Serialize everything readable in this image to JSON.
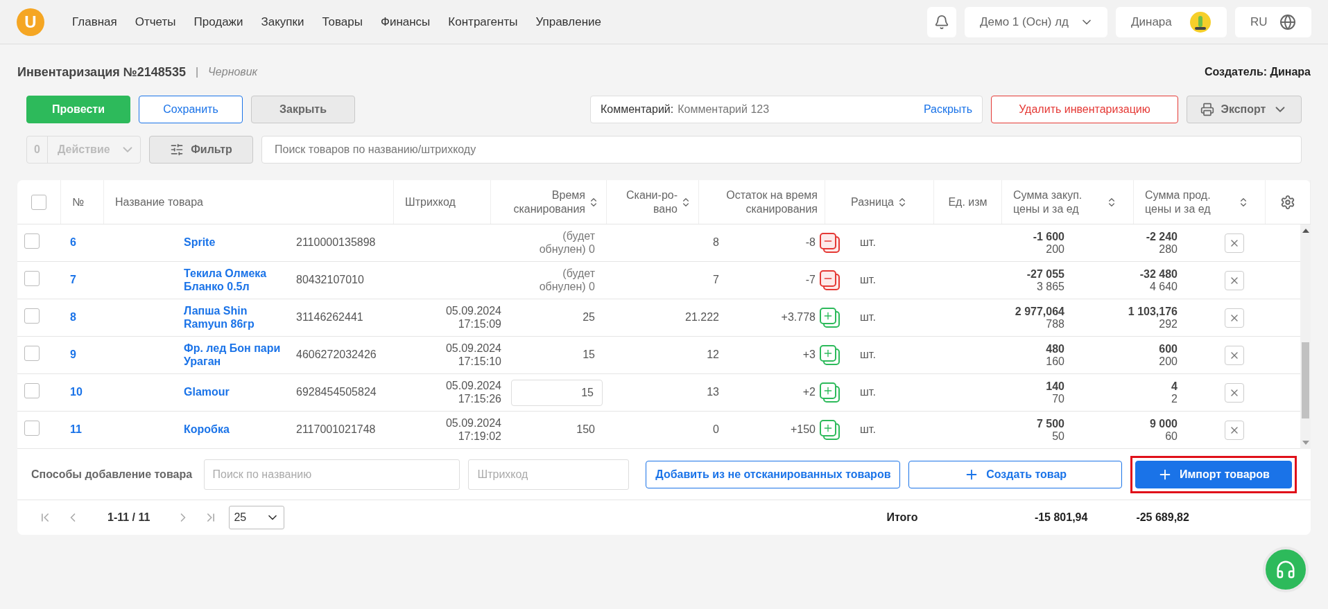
{
  "logo": "U",
  "nav": [
    "Главная",
    "Отчеты",
    "Продажи",
    "Закупки",
    "Товары",
    "Финансы",
    "Контрагенты",
    "Управление"
  ],
  "company": "Демо 1 (Осн) лд",
  "user": "Динара",
  "language": "RU",
  "doc": {
    "title": "Инвентаризация №2148535",
    "separator": "|",
    "status": "Черновик",
    "creator": "Создатель: Динара"
  },
  "actions": {
    "conduct": "Провести",
    "save": "Сохранить",
    "close": "Закрыть",
    "comment_label": "Комментарий:",
    "comment": "Комментарий 123",
    "expand": "Раскрыть",
    "delete": "Удалить инвентаризацию",
    "export": "Экспорт"
  },
  "toolbar": {
    "selected_count": "0",
    "action": "Действие",
    "filter": "Фильтр",
    "search_placeholder": "Поиск товаров по названию/штрихкоду"
  },
  "table": {
    "all_checked": false,
    "columns": [
      {
        "label": "№",
        "sortable": false
      },
      {
        "label": "Название товара",
        "sortable": false
      },
      {
        "label": "Штрихкод",
        "sortable": false
      },
      {
        "label": "Время сканирования",
        "sortable": true
      },
      {
        "label": "Скани-ро-вано",
        "sortable": true
      },
      {
        "label": "Остаток на время сканирования",
        "sortable": false
      },
      {
        "label": "Разница",
        "sortable": true
      },
      {
        "label": "Ед. изм",
        "sortable": false
      },
      {
        "label": "Сумма закуп. цены и за ед",
        "sortable": true
      },
      {
        "label": "Сумма прод. цены и за ед",
        "sortable": true
      }
    ],
    "rows": [
      {
        "checked": false,
        "no": "6",
        "name": "Sprite",
        "barcode": "2110000135898",
        "time": "",
        "scanned": {
          "kind": "reset",
          "text": "(будет обнулен) 0"
        },
        "remainder": "8",
        "difference": {
          "kind": "shortage",
          "text": "-8"
        },
        "unit": "шт.",
        "purchase": "-1 600",
        "purchase_unit": "200",
        "sale": "-2 240",
        "sale_unit": "280"
      },
      {
        "checked": false,
        "no": "7",
        "name": "Текила Олмека Бланко 0.5л",
        "barcode": "80432107010",
        "time": "",
        "scanned": {
          "kind": "reset",
          "text": "(будет обнулен) 0"
        },
        "remainder": "7",
        "difference": {
          "kind": "shortage",
          "text": "-7"
        },
        "unit": "шт.",
        "purchase": "-27 055",
        "purchase_unit": "3 865",
        "sale": "-32 480",
        "sale_unit": "4 640"
      },
      {
        "checked": false,
        "no": "8",
        "name": "Лапша Shin Ramyun 86гр",
        "barcode": "31146262441",
        "time": "05.09.2024 17:15:09",
        "scanned": {
          "kind": "text",
          "text": "25"
        },
        "remainder": "21.222",
        "difference": {
          "kind": "surplus",
          "text": "+3.778"
        },
        "unit": "шт.",
        "purchase": "2 977,064",
        "purchase_unit": "788",
        "sale": "1 103,176",
        "sale_unit": "292"
      },
      {
        "checked": false,
        "no": "9",
        "name": "Фр. лед Бон пари Ураган",
        "barcode": "4606272032426",
        "time": "05.09.2024 17:15:10",
        "scanned": {
          "kind": "text",
          "text": "15"
        },
        "remainder": "12",
        "difference": {
          "kind": "surplus",
          "text": "+3"
        },
        "unit": "шт.",
        "purchase": "480",
        "purchase_unit": "160",
        "sale": "600",
        "sale_unit": "200"
      },
      {
        "checked": false,
        "no": "10",
        "name": "Glamour",
        "barcode": "6928454505824",
        "time": "05.09.2024 17:15:26",
        "scanned": {
          "kind": "input",
          "text": "15"
        },
        "remainder": "13",
        "difference": {
          "kind": "surplus",
          "text": "+2"
        },
        "unit": "шт.",
        "purchase": "140",
        "purchase_unit": "70",
        "sale": "4",
        "sale_unit": "2"
      },
      {
        "checked": false,
        "no": "11",
        "name": "Коробка",
        "barcode": "2117001021748",
        "time": "05.09.2024 17:19:02",
        "scanned": {
          "kind": "text",
          "text": "150"
        },
        "remainder": "0",
        "difference": {
          "kind": "surplus",
          "text": "+150"
        },
        "unit": "шт.",
        "purchase": "7 500",
        "purchase_unit": "50",
        "sale": "9 000",
        "sale_unit": "60"
      }
    ]
  },
  "add_methods": {
    "label": "Способы добавление товара",
    "name_placeholder": "Поиск по названию",
    "barcode_placeholder": "Штрихкод",
    "add_unscanned": "Добавить из не отсканированных товаров",
    "create": "Создать товар",
    "import": "Импорт товаров",
    "import_highlighted": true
  },
  "pagination": {
    "range": "1-11 / 11",
    "page_size": "25"
  },
  "totals": {
    "label": "Итого",
    "purchase": "-15 801,94",
    "sale": "-25 689,82"
  }
}
